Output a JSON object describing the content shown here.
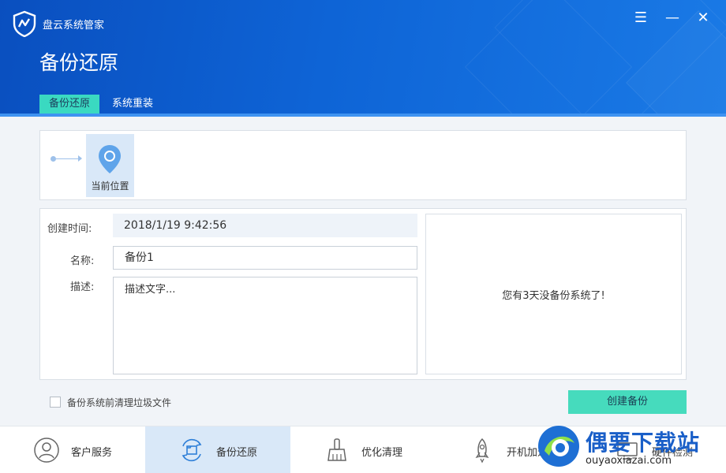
{
  "app": {
    "name": "盘云系统管家",
    "page_title": "备份还原"
  },
  "window_controls": {
    "menu": "☰",
    "minimize": "—",
    "close": "✕"
  },
  "tabs": [
    {
      "label": "备份还原",
      "active": true
    },
    {
      "label": "系统重装",
      "active": false
    }
  ],
  "timeline": {
    "node_label": "当前位置"
  },
  "form": {
    "created_label": "创建时间:",
    "created_value": "2018/1/19  9:42:56",
    "name_label": "名称:",
    "name_value": "备份1",
    "desc_label": "描述:",
    "desc_placeholder": "描述文字..."
  },
  "tip": "您有3天没备份系统了!",
  "cleanup_checkbox": {
    "label": "备份系统前清理垃圾文件",
    "checked": false
  },
  "create_button": "创建备份",
  "bottom_nav": [
    {
      "label": "客户服务",
      "icon": "user-icon",
      "active": false
    },
    {
      "label": "备份还原",
      "icon": "backup-icon",
      "active": true
    },
    {
      "label": "优化清理",
      "icon": "broom-icon",
      "active": false
    },
    {
      "label": "开机加速",
      "icon": "rocket-icon",
      "active": false
    },
    {
      "label": "硬件检测",
      "icon": "hardware-icon",
      "active": false
    }
  ],
  "watermark": {
    "title": "偶要下载站",
    "url": "ouyaoxiazai.com"
  },
  "colors": {
    "header": "#0e64d6",
    "accent": "#46dbbd",
    "active_bg": "#d9e8f8",
    "pin": "#5fa4ea"
  }
}
